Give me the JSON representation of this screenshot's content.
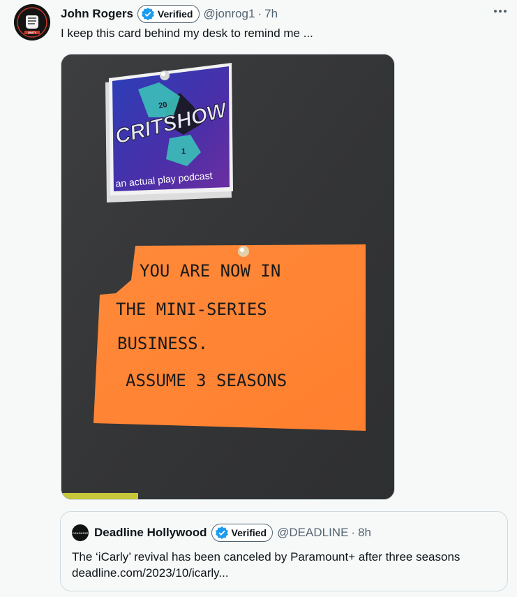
{
  "tweet": {
    "author": {
      "display_name": "John Rogers",
      "verified_label": "Verified",
      "handle": "@jonrog1",
      "time": "7h",
      "avatar_icon": "fist-logo-icon"
    },
    "separator": "·",
    "text": "I keep this card behind my desk to remind me ...",
    "media": {
      "sticker": {
        "title": "CRITSHOW",
        "subtitle": "an actual play podcast",
        "die_top": "20",
        "die_bottom": "1"
      },
      "note_lines": [
        "YOU ARE NOW IN",
        "THE MINI-SERIES",
        "BUSINESS.",
        "ASSUME 3 SEASONS"
      ]
    },
    "more_icon": "more-horizontal-icon"
  },
  "quote": {
    "author": {
      "display_name": "Deadline Hollywood",
      "verified_label": "Verified",
      "handle": "@DEADLINE",
      "time": "8h",
      "avatar_text": "DEADLINE"
    },
    "text": "The ‘iCarly’ revival has been canceled by Paramount+ after three seasons deadline.com/2023/10/icarly..."
  },
  "colors": {
    "verified_blue": "#1d9bf0",
    "secondary_text": "#536471",
    "background": "#f7f9f9",
    "note_orange": "#ff8c3a"
  }
}
